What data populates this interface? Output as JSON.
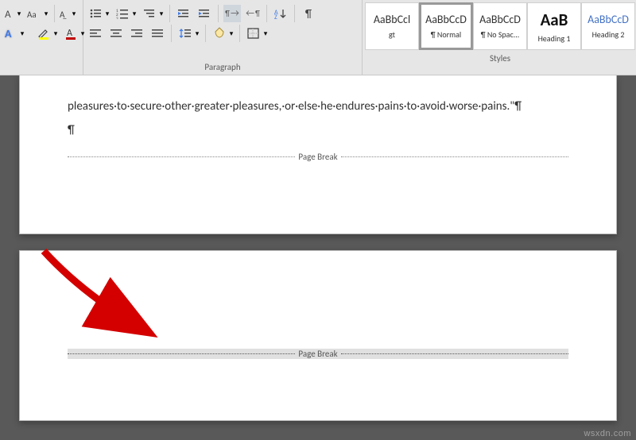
{
  "ribbon": {
    "group_paragraph_label": "Paragraph",
    "group_styles_label": "Styles"
  },
  "styles": [
    {
      "sample": "AaBbCcl",
      "name": "gt",
      "kind": "normal"
    },
    {
      "sample": "AaBbCcD",
      "name": "¶ Normal",
      "kind": "normal",
      "selected": true
    },
    {
      "sample": "AaBbCcD",
      "name": "¶ No Spac...",
      "kind": "normal"
    },
    {
      "sample": "AaB",
      "name": "Heading 1",
      "kind": "h1"
    },
    {
      "sample": "AaBbCcD",
      "name": "Heading 2",
      "kind": "h2"
    }
  ],
  "document": {
    "line1": "pleasures·to·secure·other·greater·pleasures,·or·else·he·endures·pains·to·avoid·worse·pains.\"¶",
    "pilcrow": "¶",
    "page_break_label": "Page Break"
  },
  "watermark": "wsxdn.com"
}
